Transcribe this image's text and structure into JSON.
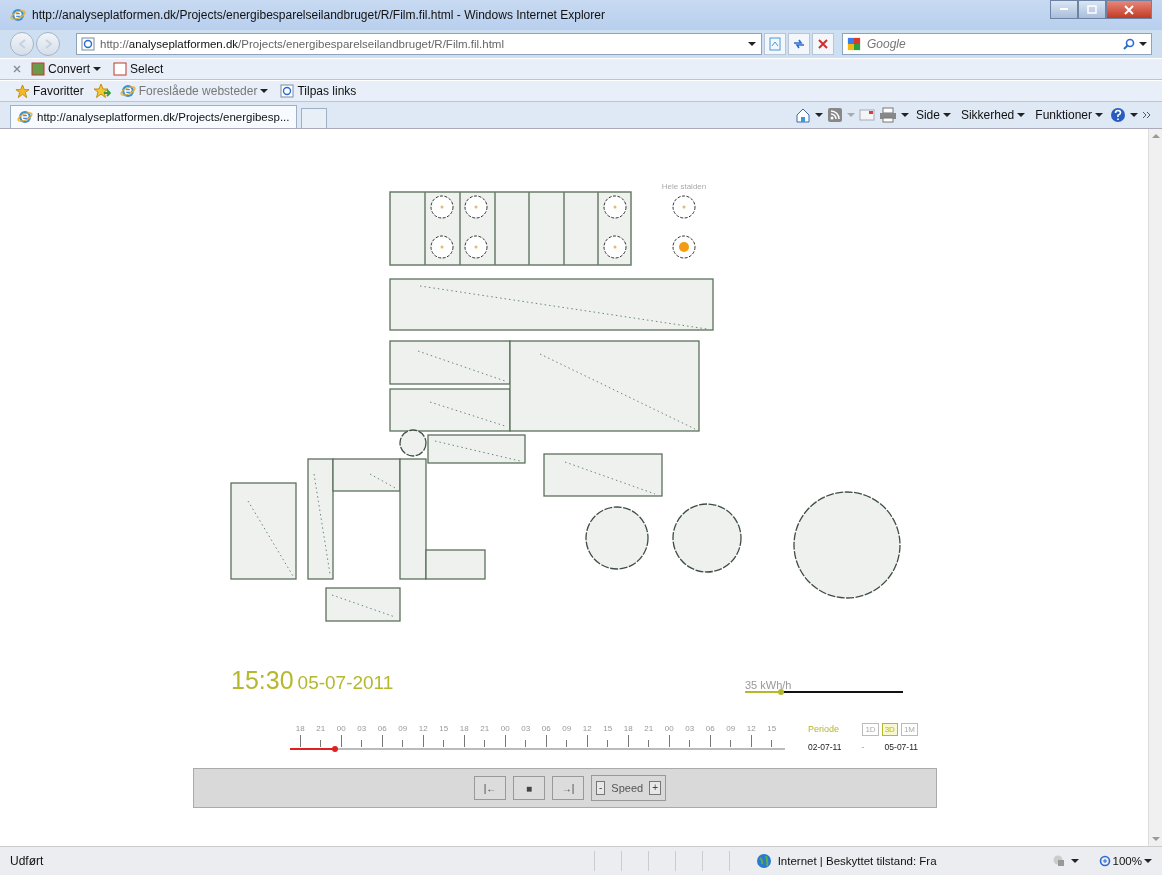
{
  "window": {
    "title": "http://analyseplatformen.dk/Projects/energibesparelseilandbruget/R/Film.fil.html - Windows Internet Explorer"
  },
  "address_bar": {
    "url": "http://**analyseplatformen.dk**/Projects/energibesparelseilandbruget/R/Film.fil.html"
  },
  "search": {
    "placeholder": "Google"
  },
  "command_bar": {
    "items": [
      "Convert",
      "Select"
    ]
  },
  "favorites_bar": {
    "items": [
      "Favoritter",
      "Foreslåede websteder",
      "Tilpas links"
    ]
  },
  "tabs": [
    {
      "label": "http://analyseplatformen.dk/Projects/energibesp...",
      "selected": true
    }
  ],
  "toolbar": {
    "menus": [
      "Side",
      "Sikkerhed",
      "Funktioner"
    ]
  },
  "floor_plan": {
    "legend_label": "Hele stalden",
    "sensors": [
      {
        "active": false
      },
      {
        "active": false
      },
      {
        "active": false
      },
      {
        "active": false
      },
      {
        "active": false
      },
      {
        "active": false
      }
    ],
    "whole_barn_sensors": [
      {
        "active": false
      },
      {
        "active": true
      }
    ]
  },
  "clock": {
    "time": "15:30",
    "date": "05-07-2011"
  },
  "meter": {
    "reading": "35 kWh/h",
    "level": 0.23
  },
  "timeline": {
    "ticks": [
      "18",
      "21",
      "00",
      "03",
      "06",
      "09",
      "12",
      "15",
      "18",
      "21",
      "00",
      "03",
      "06",
      "09",
      "12",
      "15",
      "18",
      "21",
      "00",
      "03",
      "06",
      "09",
      "12",
      "15"
    ],
    "level": 0.09
  },
  "period": {
    "label": "Periode",
    "options": [
      {
        "label": "1D",
        "selected": false
      },
      {
        "label": "3D",
        "selected": true
      },
      {
        "label": "1M",
        "selected": false
      }
    ],
    "from": "02-07-11",
    "separator": "-",
    "to": "05-07-11"
  },
  "controls": {
    "buttons": [
      "|←",
      "■",
      "→|"
    ],
    "speed_minus": "-",
    "speed_label": "Speed",
    "speed_plus": "+"
  },
  "status_bar": {
    "text": "Udført",
    "zone": "Internet | Beskyttet tilstand: Fra",
    "zoom": "100%"
  }
}
